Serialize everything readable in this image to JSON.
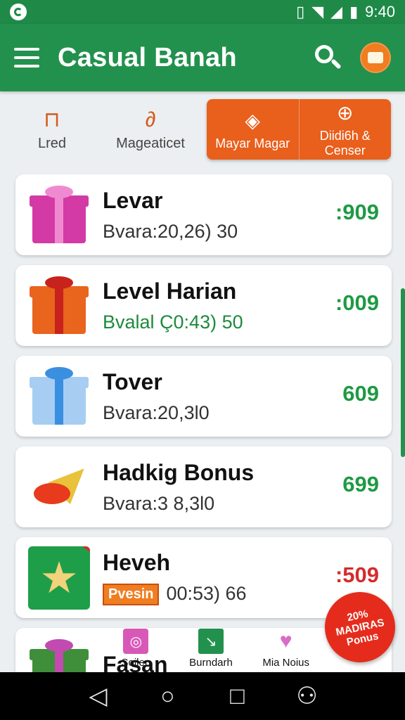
{
  "status_bar": {
    "time": "9:40"
  },
  "app_bar": {
    "title": "Casual Banah"
  },
  "tabs": [
    {
      "label": "Lred",
      "icon": "bag-icon"
    },
    {
      "label": "Mageaticet",
      "icon": "magnet-icon"
    },
    {
      "label": "Mayar Magar",
      "icon": "eye-tag-icon"
    },
    {
      "label": "Diidi6h & Censer",
      "icon": "globe-icon"
    }
  ],
  "cards": [
    {
      "title": "Levar",
      "subtitle": "Bvara:20,26) 30",
      "percent": ":909",
      "icon": "pink-gift-icon"
    },
    {
      "title": "Level Harian",
      "subtitle": "Bvalal Ç0:43) 50",
      "percent": ":009",
      "icon": "orange-gift-icon"
    },
    {
      "title": "Tover",
      "subtitle": "Bvara:20,3l0",
      "percent": "609",
      "icon": "blue-gift-icon"
    },
    {
      "title": "Hadkig Bonus",
      "subtitle": "Bvara:3 8,3l0",
      "percent": "699",
      "icon": "party-bow-icon"
    },
    {
      "title": "Heveh",
      "badge": "Pvesin",
      "subtitle": "00:53) 66",
      "percent": ":509",
      "icon": "star-tile-icon"
    },
    {
      "title": "Fasan",
      "icon": "green-gift-icon"
    }
  ],
  "bottom_nav": [
    {
      "label": "Soilen",
      "icon": "photo-icon"
    },
    {
      "label": "Burndarh",
      "icon": "graph-icon"
    },
    {
      "label": "Mia Noius",
      "icon": "heart-icon"
    }
  ],
  "promo": {
    "line1": "20%",
    "line2": "MADIRAS",
    "line3": "Ponus"
  },
  "colors": {
    "primary": "#22914d",
    "accent": "#e95f1c",
    "positive": "#1e9a44",
    "negative": "#d62b2b"
  }
}
